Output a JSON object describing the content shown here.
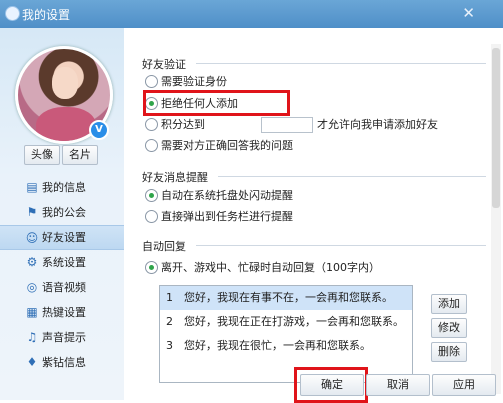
{
  "window": {
    "title": "我的设置",
    "close_glyph": "✕"
  },
  "profile": {
    "avatar_btn": "头像",
    "card_btn": "名片",
    "badge": "V"
  },
  "nav": {
    "items": [
      {
        "label": "我的信息",
        "icon": "id-card-icon",
        "glyph": "▤"
      },
      {
        "label": "我的公会",
        "icon": "flag-icon",
        "glyph": "⚑"
      },
      {
        "label": "好友设置",
        "icon": "friends-icon",
        "glyph": "☺",
        "active": true
      },
      {
        "label": "系统设置",
        "icon": "gear-icon",
        "glyph": "⚙"
      },
      {
        "label": "语音视频",
        "icon": "voice-icon",
        "glyph": "◎"
      },
      {
        "label": "热键设置",
        "icon": "keyboard-icon",
        "glyph": "▦"
      },
      {
        "label": "声音提示",
        "icon": "music-note-icon",
        "glyph": "♫"
      },
      {
        "label": "紫钻信息",
        "icon": "diamond-icon",
        "glyph": "♦"
      }
    ]
  },
  "verify": {
    "title": "好友验证",
    "opt1": "需要验证身份",
    "opt2": "拒绝任何人添加",
    "opt3_prefix": "积分达到",
    "opt3_suffix": "才允许向我申请添加好友",
    "opt4": "需要对方正确回答我的问题",
    "selected": "拒绝任何人添加"
  },
  "message": {
    "title": "好友消息提醒",
    "opt1": "自动在系统托盘处闪动提醒",
    "opt2": "直接弹出到任务栏进行提醒",
    "selected": "自动在系统托盘处闪动提醒"
  },
  "reply": {
    "title": "自动回复",
    "opt1": "离开、游戏中、忙碌时自动回复（100字内）",
    "rows": [
      {
        "num": "1",
        "text": "您好，我现在有事不在，一会再和您联系。"
      },
      {
        "num": "2",
        "text": "您好，我现在正在打游戏，一会再和您联系。"
      },
      {
        "num": "3",
        "text": "您好，我现在很忙，一会再和您联系。"
      }
    ],
    "add": "添加",
    "edit": "修改",
    "delete": "删除"
  },
  "footer": {
    "ok": "确定",
    "cancel": "取消",
    "apply": "应用"
  },
  "colors": {
    "highlight": "#e0141a",
    "title_bar": "#5b9bd0",
    "radio_on": "#2fa44a"
  }
}
